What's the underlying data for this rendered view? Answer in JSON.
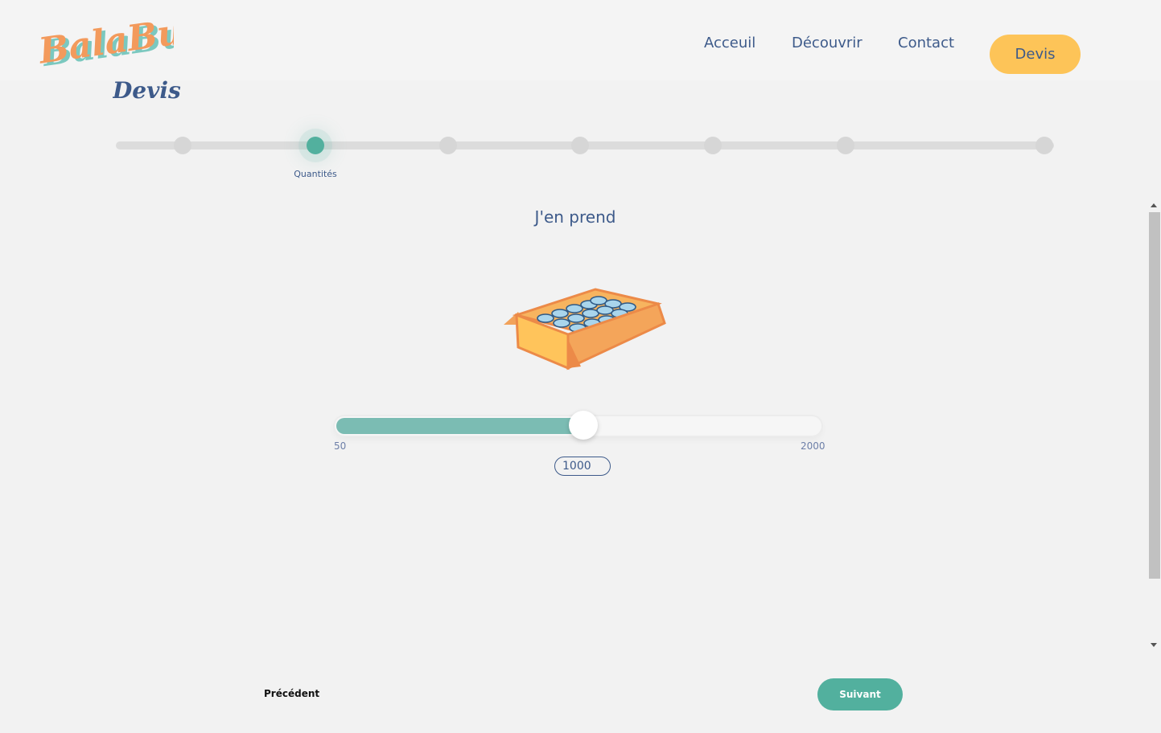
{
  "brand": {
    "logo_text": "BalaBulle",
    "page_subtitle": "Devis",
    "colors": {
      "primary": "#3d5a8a",
      "accent_teal": "#52b09e",
      "accent_yellow": "#fdc458",
      "logo_orange": "#f39a5c",
      "logo_teal": "#7bc8bf"
    }
  },
  "nav": {
    "items": [
      "Acceuil",
      "Découvrir",
      "Contact"
    ],
    "cta": "Devis"
  },
  "stepper": {
    "total_steps": 8,
    "active_index": 1,
    "active_label": "Quantités"
  },
  "question": {
    "title": "J'en prend",
    "illustration": "box-of-bottles-illustration"
  },
  "quantity": {
    "min": "50",
    "max": "2000",
    "value": "1000",
    "slider_fraction": 0.51
  },
  "footer": {
    "prev_label": "Précédent",
    "next_label": "Suivant"
  }
}
